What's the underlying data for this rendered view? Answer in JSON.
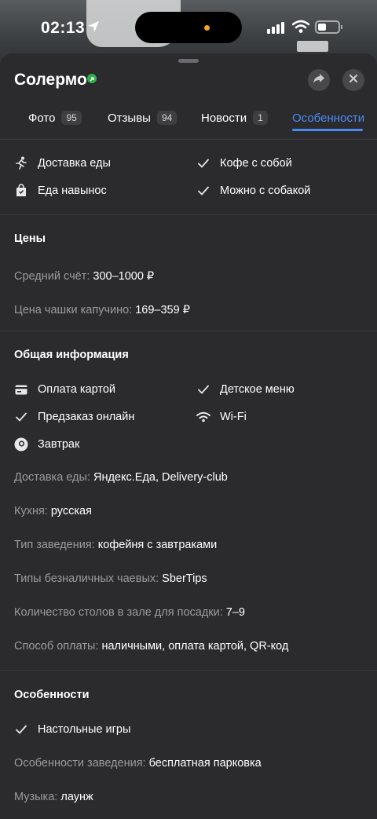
{
  "status_bar": {
    "time": "02:13"
  },
  "header": {
    "title": "Солермо"
  },
  "tabs": [
    {
      "label": "Фото",
      "count": "95"
    },
    {
      "label": "Отзывы",
      "count": "94"
    },
    {
      "label": "Новости",
      "count": "1"
    },
    {
      "label": "Особенности"
    }
  ],
  "top_features": [
    {
      "label": "Доставка еды",
      "icon": "running-person-icon"
    },
    {
      "label": "Кофе с собой",
      "icon": "check-icon"
    },
    {
      "label": "Еда навынос",
      "icon": "shopping-bag-icon"
    },
    {
      "label": "Можно с собакой",
      "icon": "check-icon"
    }
  ],
  "prices": {
    "title": "Цены",
    "rows": [
      {
        "key": "Средний счёт: ",
        "value": "300–1000 ₽"
      },
      {
        "key": "Цена чашки капучино: ",
        "value": "169–359 ₽"
      }
    ]
  },
  "general": {
    "title": "Общая информация",
    "features": [
      {
        "label": "Оплата картой",
        "icon": "card-icon"
      },
      {
        "label": "Детское меню",
        "icon": "check-icon"
      },
      {
        "label": "Предзаказ онлайн",
        "icon": "check-icon"
      },
      {
        "label": "Wi-Fi",
        "icon": "wifi-icon"
      },
      {
        "label": "Завтрак",
        "icon": "breakfast-icon"
      }
    ],
    "rows": [
      {
        "key": "Доставка еды: ",
        "value": "Яндекс.Еда, Delivery-club"
      },
      {
        "key": "Кухня: ",
        "value": "русская"
      },
      {
        "key": "Тип заведения: ",
        "value": "кофейня с завтраками"
      },
      {
        "key": "Типы безналичных чаевых: ",
        "value": "SberTips"
      },
      {
        "key": "Количество столов в зале для посадки: ",
        "value": "7–9"
      },
      {
        "key": "Способ оплаты: ",
        "value": "наличными, оплата картой, QR-код"
      }
    ]
  },
  "special": {
    "title": "Особенности",
    "features": [
      {
        "label": "Настольные игры",
        "icon": "check-icon"
      }
    ],
    "rows": [
      {
        "key": "Особенности заведения: ",
        "value": "бесплатная парковка"
      },
      {
        "key": "Музыка: ",
        "value": "лаунж"
      }
    ]
  },
  "colors": {
    "background": "#2b2b2d",
    "accent": "#4b8bf5",
    "muted_text": "#9b9ba0",
    "verified": "#2fb24c"
  }
}
